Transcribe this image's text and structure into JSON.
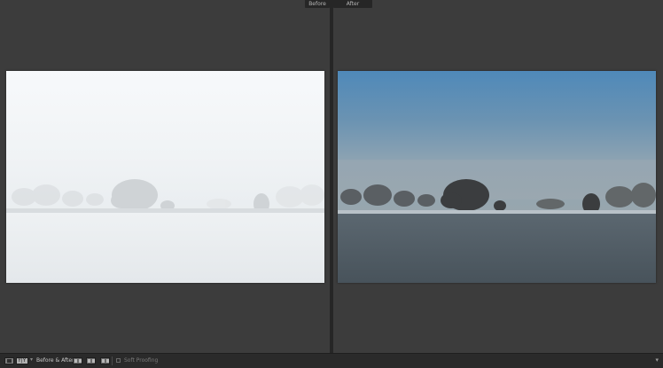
{
  "view_labels": {
    "before": "Before",
    "after": "After"
  },
  "toolbar": {
    "loupe_icon": "loupe-view-icon",
    "before_after_button": "Y|Y",
    "before_after_label": "Before & After :",
    "soft_proofing_label": "Soft Proofing",
    "menu_caret": "▾"
  },
  "colors": {
    "background": "#3c3c3c",
    "divider": "#262626",
    "toolbar": "#2a2a2a"
  }
}
